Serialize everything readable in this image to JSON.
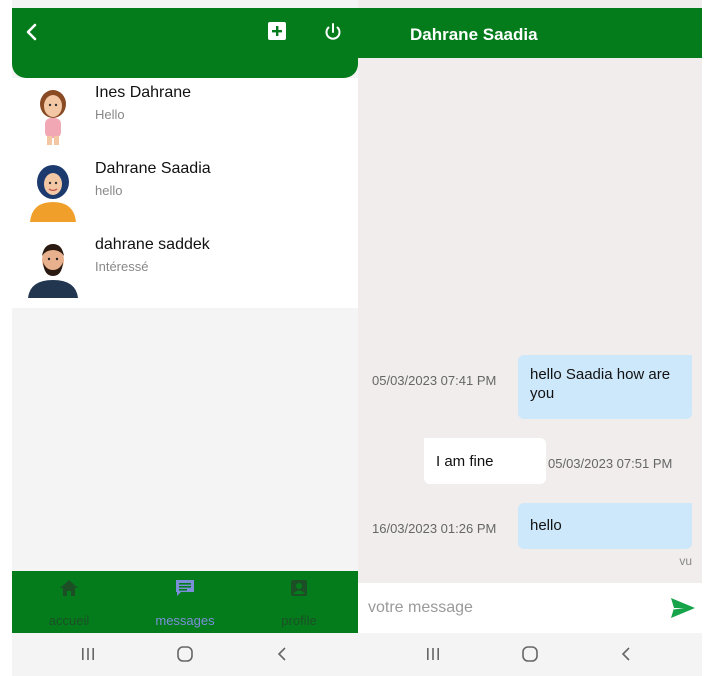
{
  "left_panel": {
    "header": {
      "back_icon": "back-arrow-icon",
      "add_icon": "plus-square-icon",
      "power_icon": "power-icon"
    },
    "contacts": [
      {
        "name": "Ines Dahrane",
        "last_message": "Hello",
        "avatar": "woman-avatar-brown-hair"
      },
      {
        "name": "Dahrane Saadia",
        "last_message": "hello",
        "avatar": "woman-avatar-blue-hijab"
      },
      {
        "name": "dahrane saddek",
        "last_message": "Intéressé",
        "avatar": "man-avatar-beard"
      }
    ],
    "bottom_nav": [
      {
        "label": "accueil",
        "icon": "home-icon"
      },
      {
        "label": "messages",
        "icon": "message-icon",
        "active": true
      },
      {
        "label": "profile",
        "icon": "profile-icon"
      }
    ]
  },
  "chat": {
    "title": "Dahrane Saadia",
    "messages": [
      {
        "direction": "sent",
        "text": "hello Saadia  how are you",
        "time": "05/03/2023 07:41 PM"
      },
      {
        "direction": "received",
        "text": "I am fine",
        "time": "05/03/2023 07:51 PM"
      },
      {
        "direction": "sent",
        "text": "hello",
        "time": "16/03/2023 01:26 PM",
        "status": "vu"
      }
    ],
    "composer": {
      "placeholder": "votre message",
      "send_icon": "send-icon"
    }
  },
  "system_nav": [
    "recent-apps-icon",
    "home-circle-icon",
    "back-chevron-icon"
  ],
  "colors": {
    "brand_green": "#047c1c",
    "sent_bubble": "#cde7fb",
    "chat_bg": "#f1eded",
    "active_nav": "#7b8fd9"
  }
}
